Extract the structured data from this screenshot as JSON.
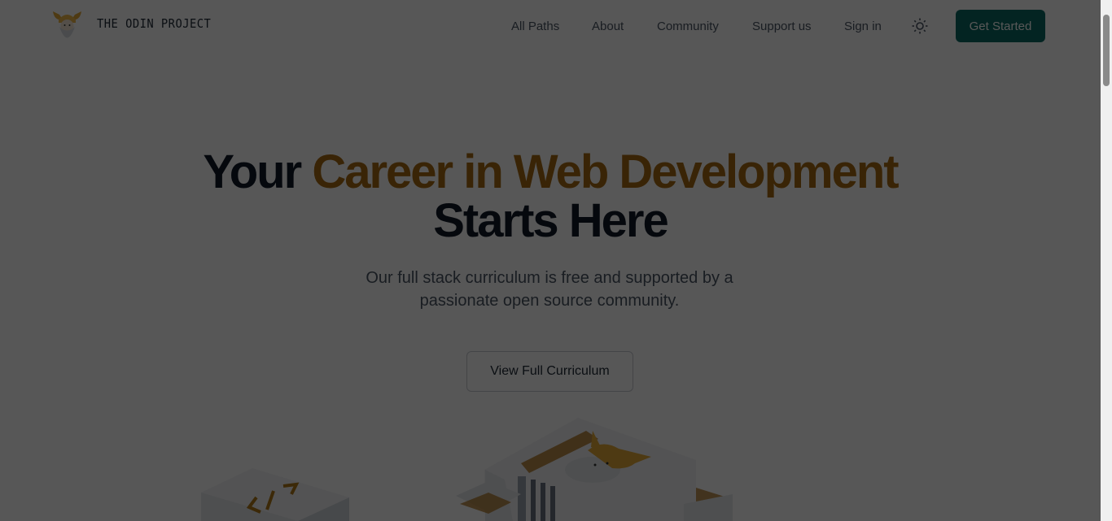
{
  "brand": {
    "name": "THE ODIN PROJECT",
    "logo_icon": "odin-viking-logo"
  },
  "nav": {
    "items": [
      {
        "label": "All Paths"
      },
      {
        "label": "About"
      },
      {
        "label": "Community"
      },
      {
        "label": "Support us"
      },
      {
        "label": "Sign in"
      }
    ],
    "theme_icon": "sun-icon",
    "cta_label": "Get Started"
  },
  "hero": {
    "title_lead": "Your",
    "title_accent": "Career in Web Development",
    "title_tail": "Starts Here",
    "subtitle": "Our full stack curriculum is free and supported by a passionate open source community.",
    "button_label": "View Full Curriculum"
  },
  "colors": {
    "accent": "#a86a12",
    "cta": "#0b6b63",
    "overlay": "rgba(0,0,0,0.66)"
  }
}
